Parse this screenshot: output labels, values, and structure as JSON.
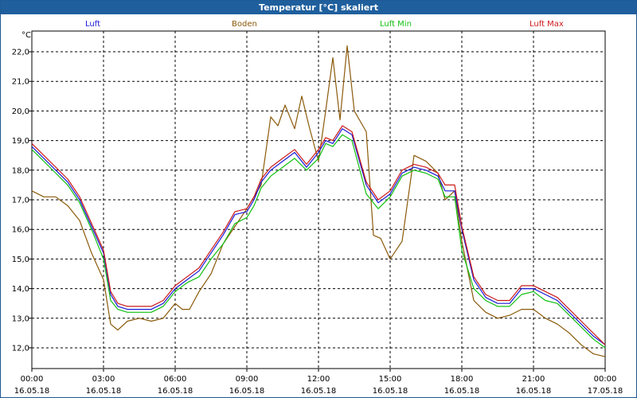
{
  "window": {
    "title": "Temperatur [°C] skaliert"
  },
  "chart_data": {
    "type": "line",
    "title": "Temperatur [°C] skaliert",
    "ylabel": "°C",
    "xlabel": "",
    "ylim": [
      11.3,
      22.7
    ],
    "xlim": [
      0,
      24
    ],
    "grid": true,
    "legend_position": "top",
    "yticks": [
      12.0,
      13.0,
      14.0,
      15.0,
      16.0,
      17.0,
      18.0,
      19.0,
      20.0,
      21.0,
      22.0
    ],
    "ytick_labels": [
      "12,0",
      "13,0",
      "14,0",
      "15,0",
      "16,0",
      "17,0",
      "18,0",
      "19,0",
      "20,0",
      "21,0",
      "22,0"
    ],
    "xticks": [
      0,
      3,
      6,
      9,
      12,
      15,
      18,
      21,
      24
    ],
    "xtick_labels": [
      [
        "00:00",
        "16.05.18"
      ],
      [
        "03:00",
        "16.05.18"
      ],
      [
        "06:00",
        "16.05.18"
      ],
      [
        "09:00",
        "16.05.18"
      ],
      [
        "12:00",
        "16.05.18"
      ],
      [
        "15:00",
        "16.05.18"
      ],
      [
        "18:00",
        "16.05.18"
      ],
      [
        "21:00",
        "16.05.18"
      ],
      [
        "00:00",
        "17.05.18"
      ]
    ],
    "series": [
      {
        "name": "Luft",
        "color": "#1a1ad8",
        "x": [
          0,
          0.5,
          1,
          1.5,
          2,
          2.5,
          3,
          3.3,
          3.6,
          4,
          4.5,
          5,
          5.5,
          6,
          6.5,
          7,
          7.5,
          8,
          8.5,
          9,
          9.3,
          9.6,
          10,
          10.5,
          11,
          11.5,
          12,
          12.3,
          12.6,
          13,
          13.4,
          14,
          14.5,
          15,
          15.5,
          16,
          16.5,
          17,
          17.3,
          17.7,
          18,
          18.5,
          19,
          19.5,
          20,
          20.5,
          21,
          21.5,
          22,
          22.5,
          23,
          23.5,
          24
        ],
        "y": [
          18.8,
          18.4,
          18.0,
          17.6,
          17.0,
          16.1,
          15.2,
          13.8,
          13.4,
          13.3,
          13.3,
          13.3,
          13.5,
          14.0,
          14.3,
          14.6,
          15.2,
          15.8,
          16.5,
          16.6,
          17.0,
          17.6,
          18.0,
          18.3,
          18.6,
          18.1,
          18.6,
          19.0,
          18.9,
          19.4,
          19.2,
          17.5,
          16.9,
          17.2,
          17.9,
          18.1,
          18.0,
          17.8,
          17.3,
          17.3,
          16.0,
          14.3,
          13.7,
          13.5,
          13.5,
          14.0,
          14.0,
          13.8,
          13.6,
          13.2,
          12.8,
          12.4,
          12.1
        ]
      },
      {
        "name": "Boden",
        "color": "#8b5a0a",
        "x": [
          0,
          0.5,
          1,
          1.5,
          2,
          2.5,
          3,
          3.3,
          3.6,
          4,
          4.5,
          5,
          5.5,
          6,
          6.3,
          6.6,
          7,
          7.5,
          8,
          8.5,
          9,
          9.3,
          9.6,
          10,
          10.3,
          10.6,
          11,
          11.3,
          11.6,
          12,
          12.3,
          12.6,
          12.9,
          13.2,
          13.5,
          14,
          14.3,
          14.6,
          15,
          15.5,
          16,
          16.5,
          17,
          17.3,
          17.7,
          18,
          18.5,
          19,
          19.5,
          20,
          20.5,
          21,
          21.5,
          22,
          22.5,
          23,
          23.5,
          24
        ],
        "y": [
          17.3,
          17.1,
          17.1,
          16.8,
          16.3,
          15.2,
          14.3,
          12.8,
          12.6,
          12.9,
          13.0,
          12.9,
          13.0,
          13.5,
          13.3,
          13.3,
          13.9,
          14.5,
          15.5,
          16.1,
          16.7,
          17.1,
          17.5,
          19.8,
          19.5,
          20.2,
          19.4,
          20.5,
          19.5,
          18.3,
          20.0,
          21.8,
          19.7,
          22.2,
          20.0,
          19.3,
          15.8,
          15.7,
          15.0,
          15.6,
          18.5,
          18.3,
          17.9,
          17.0,
          17.3,
          15.6,
          13.6,
          13.2,
          13.0,
          13.1,
          13.3,
          13.3,
          13.0,
          12.8,
          12.5,
          12.1,
          11.8,
          11.7
        ]
      },
      {
        "name": "Luft Min",
        "color": "#11c011",
        "x": [
          0,
          0.5,
          1,
          1.5,
          2,
          2.5,
          3,
          3.3,
          3.6,
          4,
          4.5,
          5,
          5.5,
          6,
          6.5,
          7,
          7.5,
          8,
          8.5,
          9,
          9.3,
          9.6,
          10,
          10.5,
          11,
          11.5,
          12,
          12.3,
          12.6,
          13,
          13.4,
          14,
          14.5,
          15,
          15.5,
          16,
          16.5,
          17,
          17.3,
          17.7,
          18,
          18.5,
          19,
          19.5,
          20,
          20.5,
          21,
          21.5,
          22,
          22.5,
          23,
          23.5,
          24
        ],
        "y": [
          18.7,
          18.3,
          17.9,
          17.5,
          16.9,
          16.0,
          15.0,
          13.6,
          13.3,
          13.2,
          13.2,
          13.2,
          13.4,
          13.9,
          14.2,
          14.4,
          15.0,
          15.5,
          16.2,
          16.4,
          16.8,
          17.4,
          17.8,
          18.1,
          18.4,
          18.0,
          18.4,
          18.9,
          18.8,
          19.2,
          19.0,
          17.2,
          16.7,
          17.1,
          17.8,
          18.0,
          17.9,
          17.7,
          17.1,
          17.1,
          15.3,
          14.0,
          13.6,
          13.4,
          13.4,
          13.8,
          13.9,
          13.6,
          13.5,
          13.1,
          12.7,
          12.3,
          12.0
        ]
      },
      {
        "name": "Luft Max",
        "color": "#cc1a1a",
        "x": [
          0,
          0.5,
          1,
          1.5,
          2,
          2.5,
          3,
          3.3,
          3.6,
          4,
          4.5,
          5,
          5.5,
          6,
          6.5,
          7,
          7.5,
          8,
          8.5,
          9,
          9.3,
          9.6,
          10,
          10.5,
          11,
          11.5,
          12,
          12.3,
          12.6,
          13,
          13.4,
          14,
          14.5,
          15,
          15.5,
          16,
          16.5,
          17,
          17.3,
          17.7,
          18,
          18.5,
          19,
          19.5,
          20,
          20.5,
          21,
          21.5,
          22,
          22.5,
          23,
          23.5,
          24
        ],
        "y": [
          18.9,
          18.5,
          18.1,
          17.7,
          17.1,
          16.2,
          15.3,
          13.9,
          13.5,
          13.4,
          13.4,
          13.4,
          13.6,
          14.1,
          14.4,
          14.7,
          15.3,
          15.9,
          16.6,
          16.7,
          17.1,
          17.7,
          18.1,
          18.4,
          18.7,
          18.2,
          18.7,
          19.1,
          19.0,
          19.5,
          19.3,
          17.6,
          17.0,
          17.3,
          18.0,
          18.2,
          18.1,
          17.9,
          17.5,
          17.5,
          16.1,
          14.4,
          13.8,
          13.6,
          13.6,
          14.1,
          14.1,
          13.9,
          13.7,
          13.3,
          12.9,
          12.5,
          12.1
        ]
      }
    ]
  }
}
